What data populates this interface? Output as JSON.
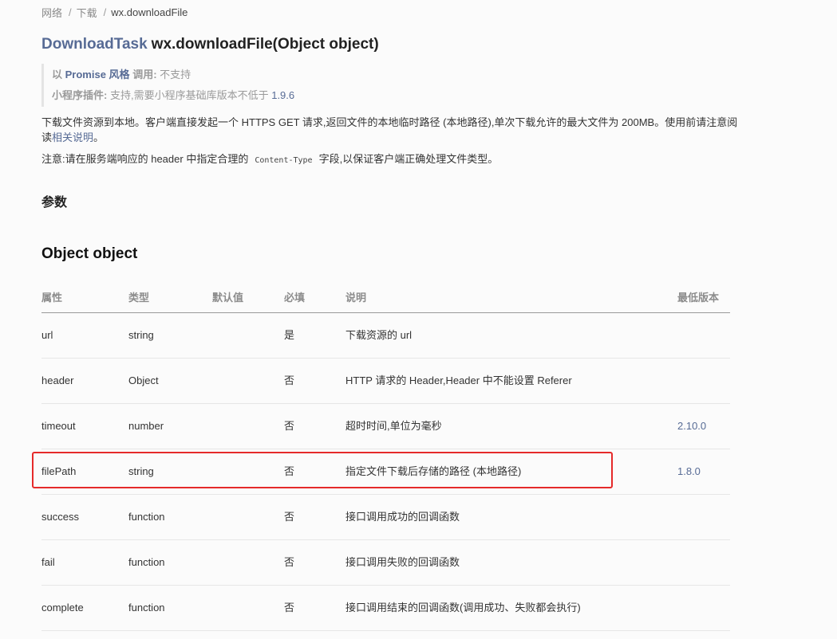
{
  "breadcrumb": {
    "items": [
      "网络",
      "下载",
      "wx.downloadFile"
    ],
    "separator": "/"
  },
  "title": {
    "return_type": "DownloadTask",
    "signature": "wx.downloadFile(Object object)"
  },
  "support": {
    "promise_prefix": "以",
    "promise_link": "Promise 风格",
    "promise_label": "调用:",
    "promise_value": "不支持",
    "plugin_label": "小程序插件:",
    "plugin_value": "支持,需要小程序基础库版本不低于",
    "plugin_version": "1.9.6"
  },
  "description": {
    "text": "下载文件资源到本地。客户端直接发起一个 HTTPS GET 请求,返回文件的本地临时路径 (本地路径),单次下载允许的最大文件为 200MB。使用前请注意阅读",
    "link": "相关说明",
    "end": "。"
  },
  "note": {
    "prefix": "注意:请在服务端响应的 header 中指定合理的",
    "code": "Content-Type",
    "suffix": "字段,以保证客户端正确处理文件类型。"
  },
  "params_heading": "参数",
  "object_heading": "Object object",
  "table": {
    "columns": [
      "属性",
      "类型",
      "默认值",
      "必填",
      "说明",
      "最低版本"
    ],
    "rows": [
      {
        "name": "url",
        "type": "string",
        "default": "",
        "required": "是",
        "desc": "下载资源的 url",
        "version": ""
      },
      {
        "name": "header",
        "type": "Object",
        "default": "",
        "required": "否",
        "desc": "HTTP 请求的 Header,Header 中不能设置 Referer",
        "version": ""
      },
      {
        "name": "timeout",
        "type": "number",
        "default": "",
        "required": "否",
        "desc": "超时时间,单位为毫秒",
        "version": "2.10.0"
      },
      {
        "name": "filePath",
        "type": "string",
        "default": "",
        "required": "否",
        "desc": "指定文件下载后存储的路径 (本地路径)",
        "version": "1.8.0"
      },
      {
        "name": "success",
        "type": "function",
        "default": "",
        "required": "否",
        "desc": "接口调用成功的回调函数",
        "version": ""
      },
      {
        "name": "fail",
        "type": "function",
        "default": "",
        "required": "否",
        "desc": "接口调用失败的回调函数",
        "version": ""
      },
      {
        "name": "complete",
        "type": "function",
        "default": "",
        "required": "否",
        "desc": "接口调用结束的回调函数(调用成功、失败都会执行)",
        "version": ""
      }
    ]
  },
  "colors": {
    "link": "#576b95",
    "highlight": "#e52a2a",
    "muted": "#9a9a9a"
  }
}
